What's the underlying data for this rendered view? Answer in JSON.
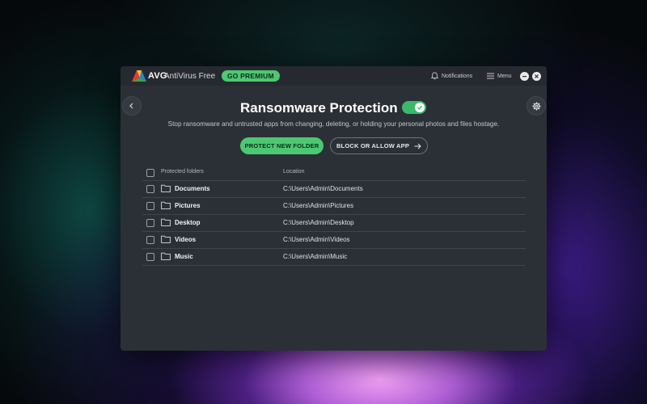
{
  "titlebar": {
    "brand": "AVG",
    "product": "AntiVirus Free",
    "premium_label": "GO PREMIUM",
    "notifications_label": "Notifications",
    "menu_label": "Menu"
  },
  "page": {
    "title": "Ransomware Protection",
    "protection_enabled": true,
    "subtitle": "Stop ransomware and untrusted apps from changing, deleting, or holding your personal photos and files hostage.",
    "primary_button": "PROTECT NEW FOLDER",
    "secondary_button": "BLOCK OR ALLOW APP"
  },
  "table": {
    "headers": {
      "folders": "Protected folders",
      "location": "Location"
    },
    "rows": [
      {
        "name": "Documents",
        "location": "C:\\Users\\Admin\\Documents"
      },
      {
        "name": "Pictures",
        "location": "C:\\Users\\Admin\\Pictures"
      },
      {
        "name": "Desktop",
        "location": "C:\\Users\\Admin\\Desktop"
      },
      {
        "name": "Videos",
        "location": "C:\\Users\\Admin\\Videos"
      },
      {
        "name": "Music",
        "location": "C:\\Users\\Admin\\Music"
      }
    ]
  },
  "icons": [
    "avg-logo-icon",
    "bell-icon",
    "hamburger-menu-icon",
    "minimize-icon",
    "close-icon",
    "back-arrow-icon",
    "gear-icon",
    "check-icon",
    "arrow-right-icon",
    "folder-icon"
  ],
  "colors": {
    "accent": "#4cc872",
    "window_bg": "#2b3036",
    "titlebar_bg": "#262a30"
  }
}
